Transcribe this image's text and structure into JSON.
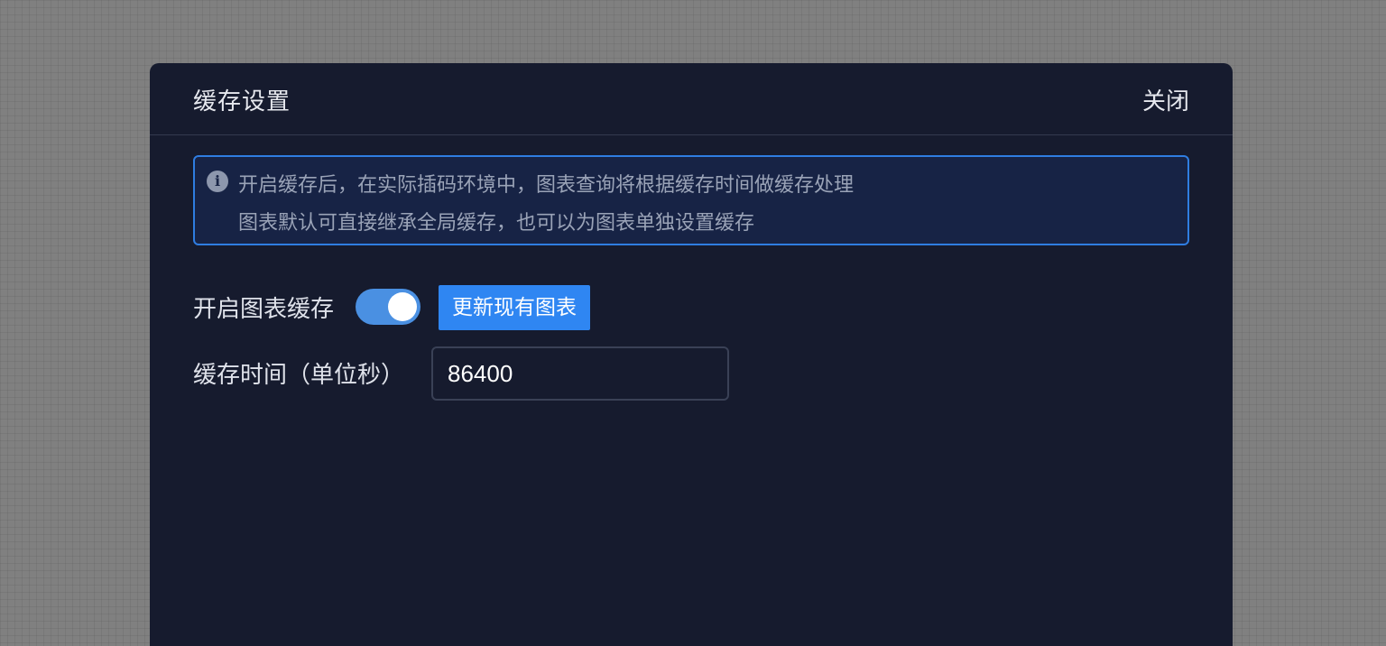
{
  "dialog": {
    "title": "缓存设置",
    "close_label": "关闭"
  },
  "notice": {
    "icon": "info-icon",
    "icon_glyph": "i",
    "line1": "开启缓存后，在实际插码环境中，图表查询将根据缓存时间做缓存处理",
    "line2": "图表默认可直接继承全局缓存，也可以为图表单独设置缓存"
  },
  "form": {
    "enable_label": "开启图表缓存",
    "enable_checked": true,
    "update_button_label": "更新现有图表",
    "time_label": "缓存时间（单位秒）",
    "time_value": "86400"
  },
  "colors": {
    "accent": "#2f86f2",
    "dialog_bg": "#161b2e",
    "notice_border": "#2f7de1",
    "toggle_on": "#4a90e2"
  }
}
